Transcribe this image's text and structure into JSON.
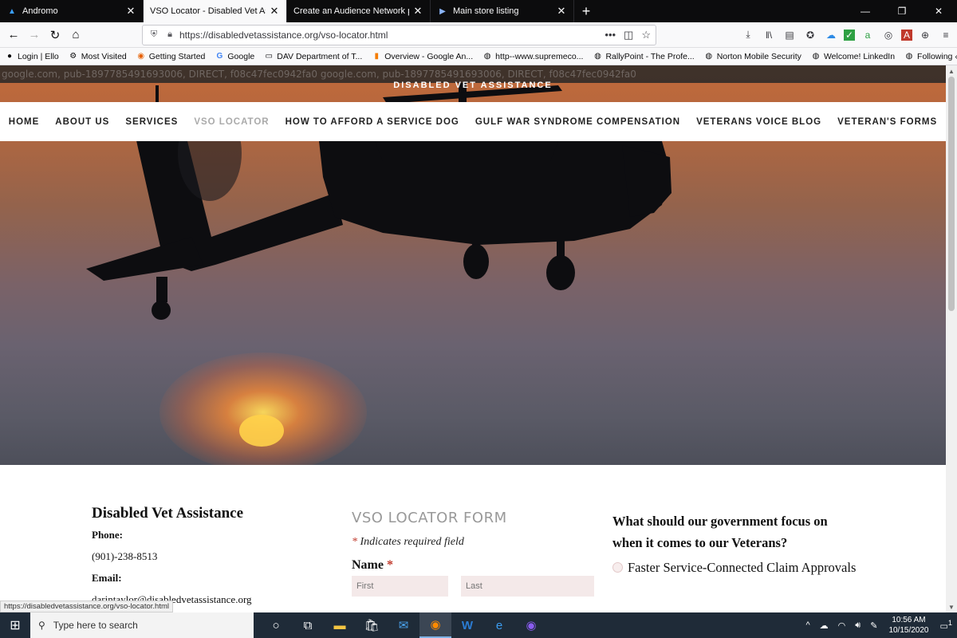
{
  "browser": {
    "tabs": [
      {
        "title": "Andromo",
        "active": false
      },
      {
        "title": "VSO Locator - Disabled Vet Assistan",
        "active": true
      },
      {
        "title": "Create an Audience Network placem",
        "active": false
      },
      {
        "title": "Main store listing",
        "active": false
      }
    ],
    "url": "https://disabledvetassistance.org/vso-locator.html",
    "bookmarks": [
      "Login | Ello",
      "Most Visited",
      "Getting Started",
      "Google",
      "DAV Department of T...",
      "Overview - Google An...",
      "http--www.supremeco...",
      "RallyPoint - The Profe...",
      "Norton Mobile Security",
      "Welcome! LinkedIn",
      "Following ‹ Reader —..."
    ],
    "status_url": "https://disabledvetassistance.org/vso-locator.html"
  },
  "page": {
    "ad_text": "google.com, pub-1897785491693006, DIRECT, f08c47fec0942fa0 google.com, pub-1897785491693006, DIRECT, f08c47fec0942fa0",
    "site_title": "DISABLED VET ASSISTANCE",
    "nav": [
      {
        "label": "HOME",
        "current": false
      },
      {
        "label": "ABOUT US",
        "current": false
      },
      {
        "label": "SERVICES",
        "current": false
      },
      {
        "label": "VSO LOCATOR",
        "current": true
      },
      {
        "label": "HOW TO AFFORD A SERVICE DOG",
        "current": false
      },
      {
        "label": "GULF WAR SYNDROME COMPENSATION",
        "current": false
      },
      {
        "label": "VETERANS VOICE BLOG",
        "current": false
      },
      {
        "label": "VETERAN'S FORMS",
        "current": false
      }
    ],
    "contact": {
      "org": "Disabled Vet Assistance",
      "phone_label": "Phone:",
      "phone": " (901)-238-8513",
      "email_label": "Email:",
      "email": "darintaylor@disabledvetassistance.org"
    },
    "form": {
      "title": "VSO LOCATOR FORM",
      "required_star": "*",
      "required_note": " Indicates required field",
      "name_label": "Name ",
      "first_placeholder": "First",
      "last_placeholder": "Last"
    },
    "survey": {
      "question": "What should our government focus on when it comes to our Veterans?",
      "option1": "Faster Service-Connected Claim Approvals"
    }
  },
  "taskbar": {
    "search_placeholder": "Type here to search",
    "time": "10:56 AM",
    "date": "10/15/2020",
    "notification_count": "1"
  }
}
